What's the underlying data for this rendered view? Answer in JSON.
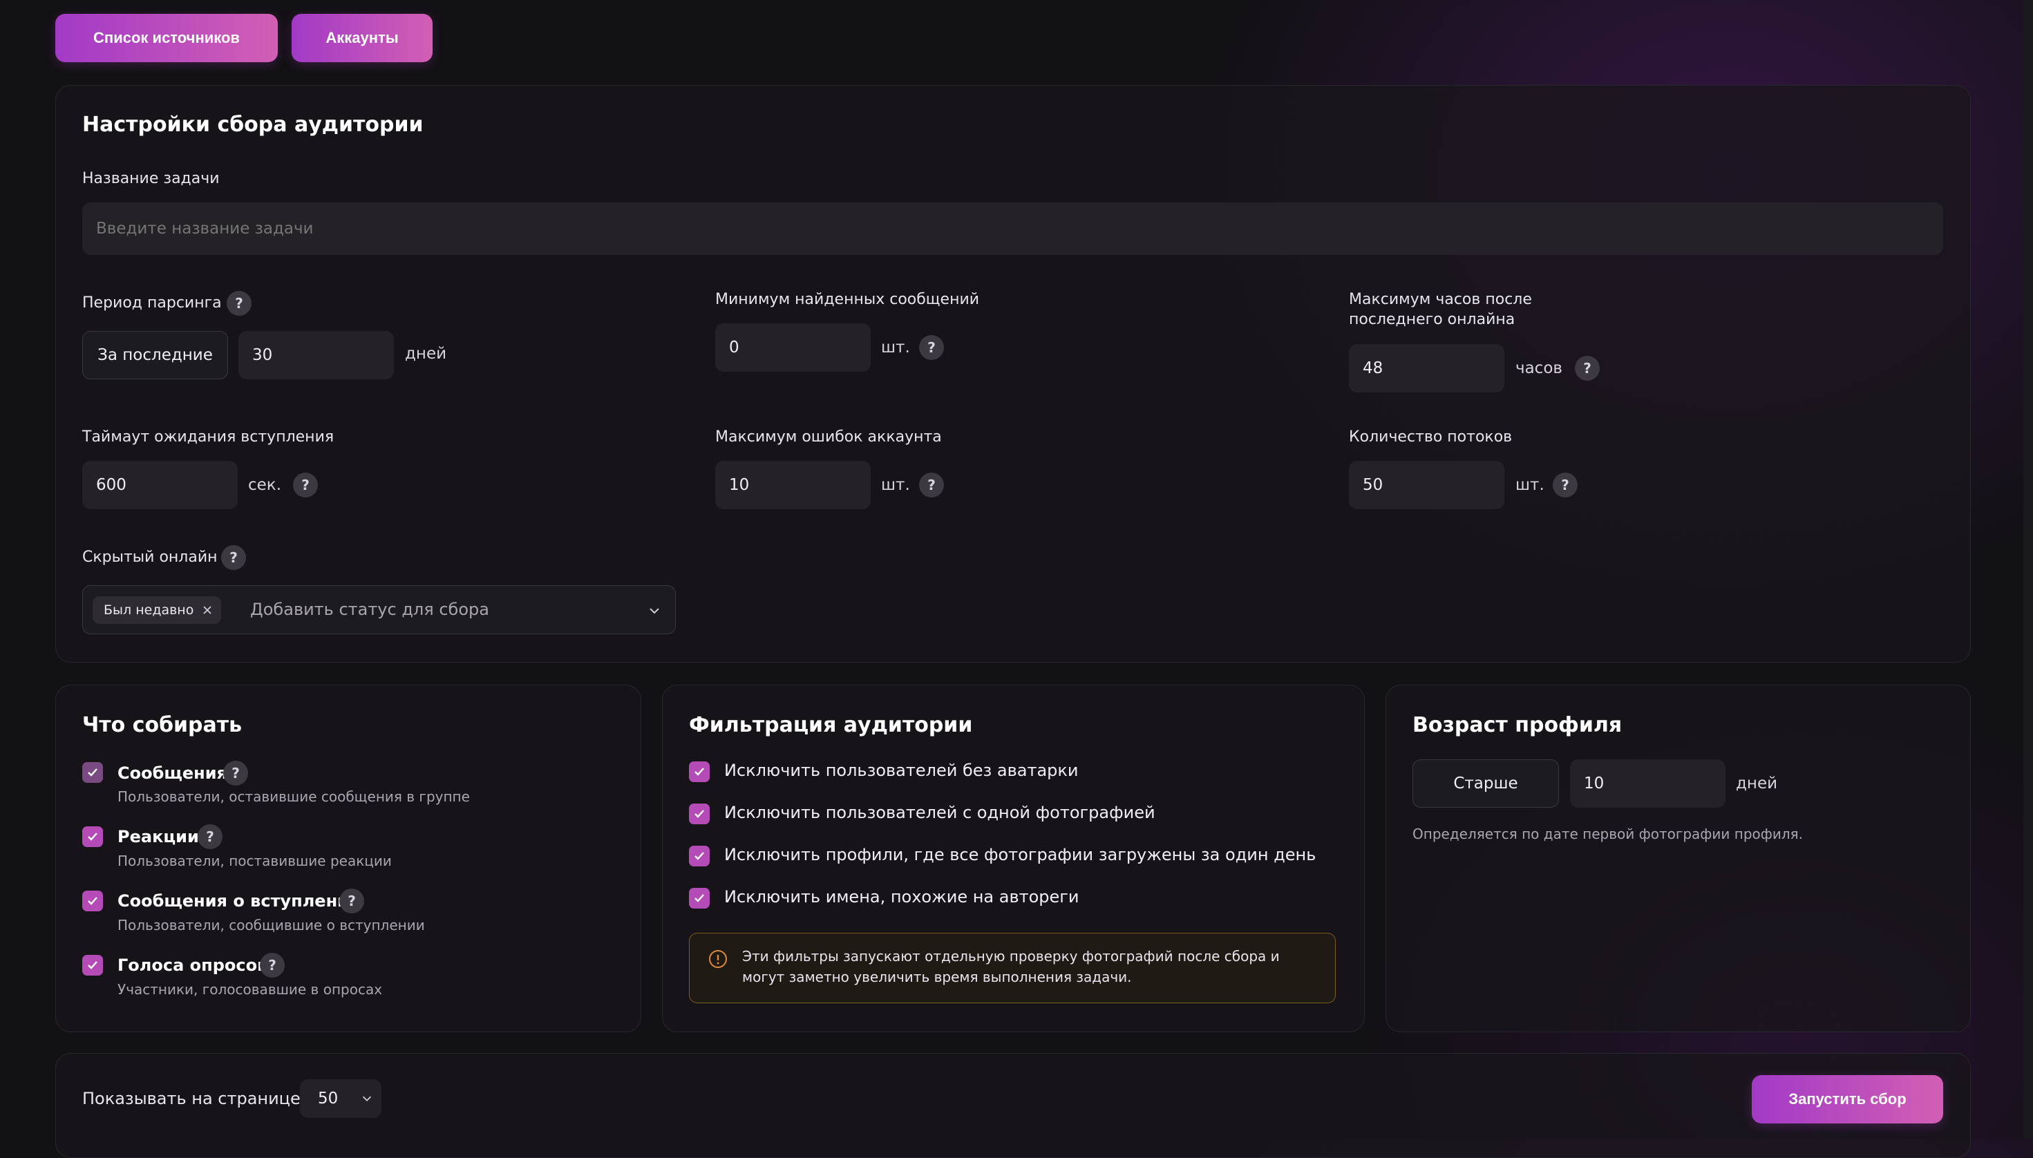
{
  "toolbar": {
    "sources_label": "Список источников",
    "accounts_label": "Аккаунты"
  },
  "settings": {
    "title": "Настройки сбора аудитории",
    "task_name": {
      "label": "Название задачи",
      "placeholder": "Введите название задачи",
      "value": ""
    },
    "parse_period": {
      "label": "Период парсинга",
      "mode": "За последние",
      "value": "30",
      "unit": "дней"
    },
    "min_messages": {
      "label": "Минимум найденных сообщений",
      "value": "0",
      "unit": "шт."
    },
    "max_hours": {
      "label_line1": "Максимум часов после",
      "label_line2": "последнего онлайна",
      "value": "48",
      "unit": "часов"
    },
    "join_timeout": {
      "label": "Таймаут ожидания вступления",
      "value": "600",
      "unit": "сек."
    },
    "max_errors": {
      "label": "Максимум ошибок аккаунта",
      "value": "10",
      "unit": "шт."
    },
    "threads": {
      "label": "Количество потоков",
      "value": "50",
      "unit": "шт."
    },
    "hidden_online": {
      "label": "Скрытый онлайн",
      "tag": "Был недавно",
      "placeholder": "Добавить статус для сбора"
    }
  },
  "collect": {
    "title": "Что собирать",
    "items": [
      {
        "title": "Сообщения",
        "subtitle": "Пользователи, оставившие сообщения в группе",
        "checked": true
      },
      {
        "title": "Реакции",
        "subtitle": "Пользователи, поставившие реакции",
        "checked": true
      },
      {
        "title": "Сообщения о вступлении",
        "subtitle": "Пользователи, сообщившие о вступлении",
        "checked": true
      },
      {
        "title": "Голоса опросов",
        "subtitle": "Участники, голосовавшие в опросах",
        "checked": true
      }
    ]
  },
  "filter": {
    "title": "Фильтрация аудитории",
    "items": [
      {
        "text": "Исключить пользователей без аватарки",
        "checked": true
      },
      {
        "text": "Исключить пользователей с одной фотографией",
        "checked": true
      },
      {
        "text": "Исключить профили, где все фотографии загружены за один день",
        "checked": true
      },
      {
        "text": "Исключить имена, похожие на автореги",
        "checked": true
      }
    ],
    "warning_line1": "Эти фильтры запускают отдельную проверку фотографий после сбора и",
    "warning_line2": "могут заметно увеличить время выполнения задачи."
  },
  "age": {
    "title": "Возраст профиля",
    "mode": "Старше",
    "value": "10",
    "unit": "дней",
    "hint": "Определяется по дате первой фотографии профиля."
  },
  "footer": {
    "per_page_label": "Показывать на странице",
    "per_page_value": "50",
    "start_label": "Запустить сбор"
  },
  "colors": {
    "accent": "#b54bb7",
    "background": "#121114",
    "panel": "#18161b",
    "warning_border": "#7a5a22"
  }
}
